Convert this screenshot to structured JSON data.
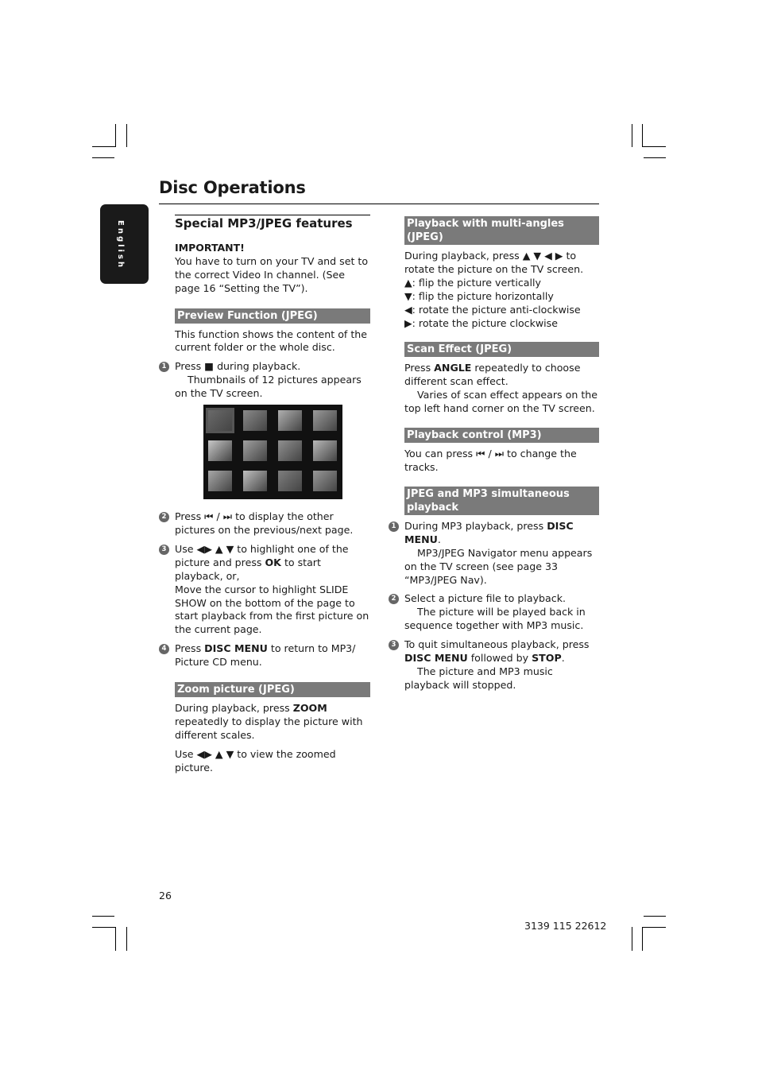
{
  "page": {
    "title": "Disc Operations",
    "language_tab": "English",
    "page_number": "26",
    "doc_code": "3139 115 22612"
  },
  "left": {
    "section_title": "Special MP3/JPEG features",
    "important_label": "IMPORTANT!",
    "important_text": "You have to turn on your TV and set to the correct Video In channel.  (See page 16 “Setting the TV”).",
    "preview": {
      "bar": "Preview Function (JPEG)",
      "intro": "This function shows the content of the current folder or the whole disc.",
      "steps": [
        {
          "n": "1",
          "pre": "Press ",
          "icon": "■",
          "post": " during playback.",
          "note": "Thumbnails of 12 pictures appears on the TV screen."
        },
        {
          "n": "2",
          "pre": "Press ",
          "icon": "⏮ / ⏭",
          "post": " to display the other pictures on the previous/next page."
        },
        {
          "n": "3",
          "pre": "Use ◀▶ ▲ ▼ to highlight one of the picture and press ",
          "bold": "OK",
          "post": " to start playback, or,",
          "extra": "Move the cursor to highlight SLIDE SHOW on the bottom of the page to start playback from the first picture on the current page."
        },
        {
          "n": "4",
          "pre": "Press ",
          "bold": "DISC MENU",
          "post": " to return to MP3/ Picture CD menu."
        }
      ]
    },
    "zoom": {
      "bar": "Zoom picture (JPEG)",
      "pre": "During playback, press ",
      "bold": "ZOOM",
      "post": " repeatedly to display the picture with different scales.",
      "line2": "Use ◀▶ ▲ ▼ to view the zoomed picture."
    },
    "thumbnails_count": 12
  },
  "right": {
    "angles": {
      "bar": "Playback with multi-angles (JPEG)",
      "intro": "During playback, press ▲ ▼ ◀ ▶ to rotate the picture on the TV screen.",
      "lines": [
        "▲: flip the picture vertically",
        "▼: flip the picture horizontally",
        "◀: rotate the picture anti-clockwise",
        "▶: rotate the picture clockwise"
      ]
    },
    "scan": {
      "bar": "Scan Effect (JPEG)",
      "pre": "Press ",
      "bold": "ANGLE",
      "post": " repeatedly to choose different scan effect.",
      "note": "Varies of scan effect appears on the top left hand corner on the TV screen."
    },
    "control": {
      "bar": "Playback control (MP3)",
      "text": "You can press ⏮ / ⏭ to change the tracks."
    },
    "simul": {
      "bar": "JPEG and MP3 simultaneous playback",
      "steps": [
        {
          "n": "1",
          "pre": "During MP3 playback, press ",
          "bold": "DISC MENU",
          "post": ".",
          "note": "MP3/JPEG Navigator menu appears on the TV screen (see page 33 “MP3/JPEG Nav)."
        },
        {
          "n": "2",
          "pre": "Select a picture file to playback.",
          "note": "The picture will be played back in sequence together with MP3 music."
        },
        {
          "n": "3",
          "pre": "To quit simultaneous playback, press ",
          "bold": "DISC MENU",
          "mid": " followed by ",
          "bold2": "STOP",
          "post": ".",
          "note": "The picture and MP3 music playback will stopped."
        }
      ]
    }
  }
}
